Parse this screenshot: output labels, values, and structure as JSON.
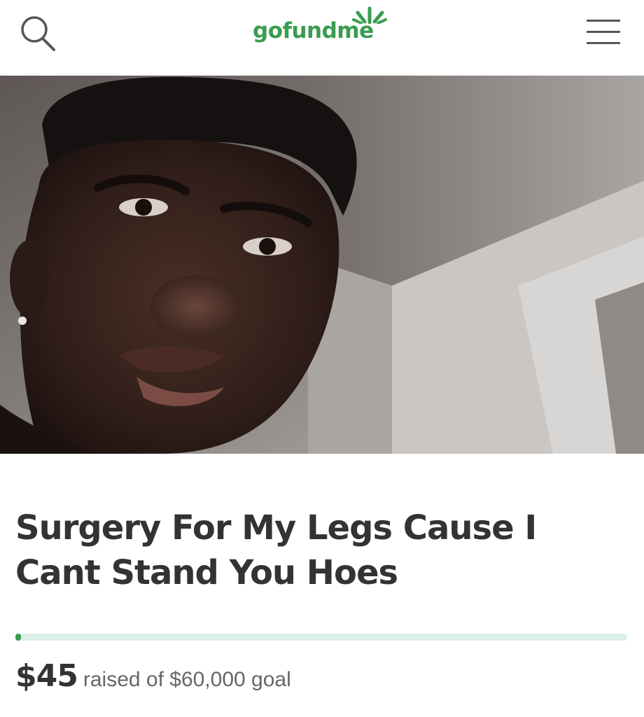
{
  "header": {
    "search_icon": "search-icon",
    "logo_text": "gofundme",
    "menu_icon": "hamburger-menu-icon",
    "brand_color": "#3a9c4f"
  },
  "campaign": {
    "title": "Surgery For My Legs Cause I Cant Stand You Hoes",
    "raised": "$45",
    "raised_suffix": "raised of $60,000 goal",
    "progress_fraction": 0.00075,
    "progress_track_color": "#dbeee7"
  }
}
